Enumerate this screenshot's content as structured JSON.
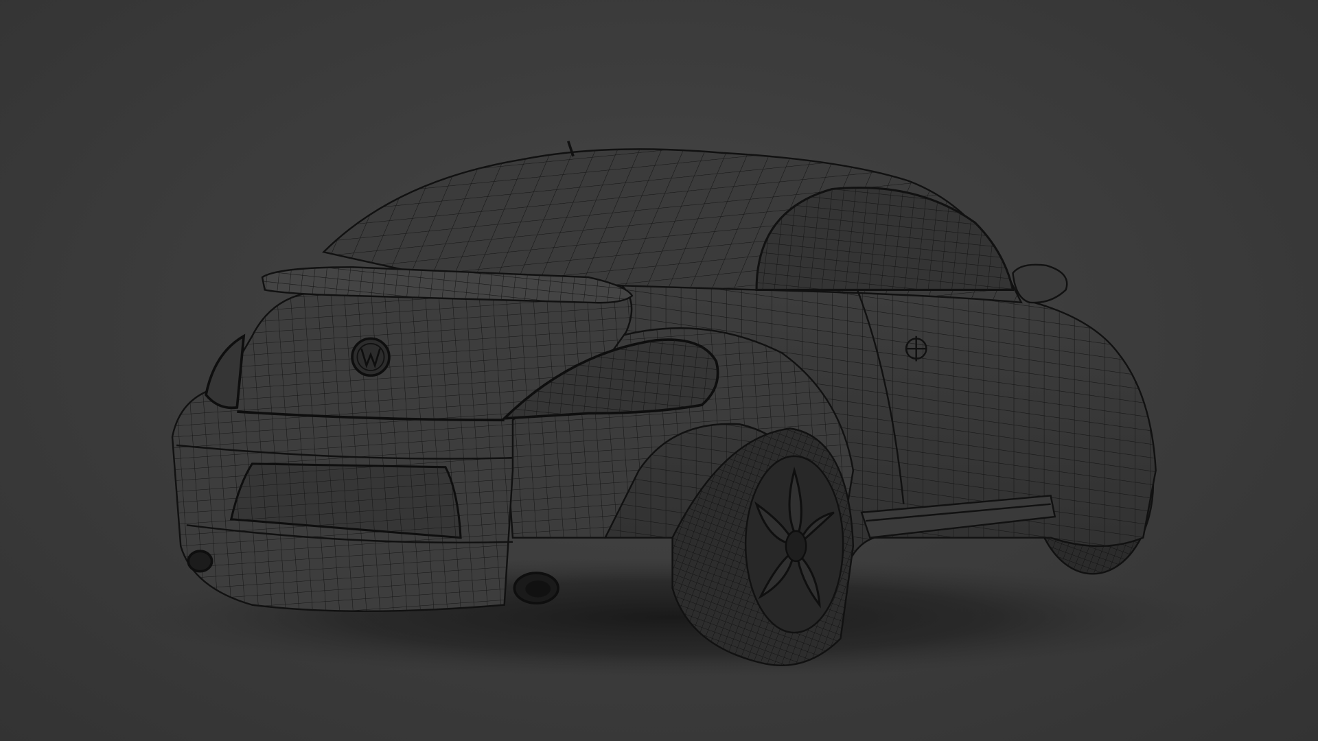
{
  "scene": {
    "background_color": "#3b3b3b",
    "model_color": "#3a3a3a",
    "wire_color": "#111111",
    "subject": "car-wireframe-render"
  }
}
